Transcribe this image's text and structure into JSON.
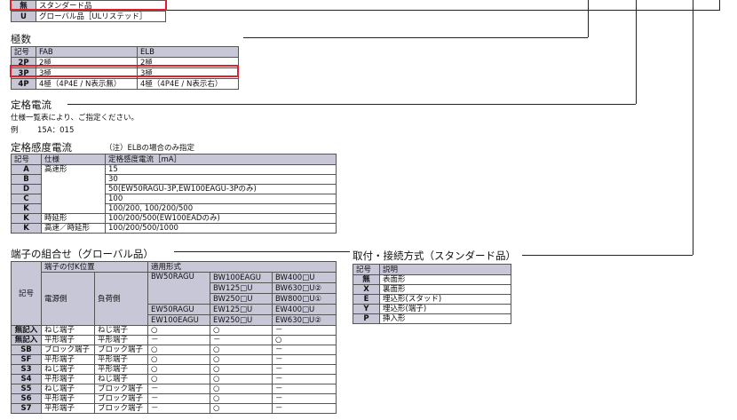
{
  "top_table": {
    "rows": [
      {
        "code": "無",
        "desc": "スタンダード品"
      },
      {
        "code": "U",
        "desc": "グローバル品［ULリステッド］"
      }
    ]
  },
  "poles": {
    "title": "極数",
    "headers": [
      "記号",
      "FAB",
      "ELB"
    ],
    "rows": [
      {
        "code": "2P",
        "fab": "2極",
        "elb": "2極"
      },
      {
        "code": "3P",
        "fab": "3極",
        "elb": "3極"
      },
      {
        "code": "4P",
        "fab": "4極（4P4E / N表示無）",
        "elb": "4極（4P4E / N表示右）"
      }
    ]
  },
  "rated_current": {
    "title": "定格電流",
    "line1": "仕様一覧表により、ご指定ください。",
    "example_label": "例",
    "example_value": "15A：015"
  },
  "sensitivity": {
    "title": "定格感度電流",
    "note": "（注）ELBの場合のみ指定",
    "headers": [
      "記号",
      "仕様",
      "定格感度電流［mA］"
    ],
    "spec_fast": "高速形",
    "rows": [
      {
        "code": "A",
        "value": "15"
      },
      {
        "code": "B",
        "value": "30"
      },
      {
        "code": "D",
        "value": "50(EW50RAGU-3P,EW100EAGU-3Pのみ)"
      },
      {
        "code": "C",
        "value": "100"
      },
      {
        "code": "K",
        "value": "100/200, 100/200/500"
      },
      {
        "code": "K",
        "spec": "時延形",
        "value": "100/200/500(EW100EADのみ)"
      },
      {
        "code": "K",
        "spec": "高速／時延形",
        "value": "100/200/500/1000"
      }
    ]
  },
  "terminals": {
    "title": "端子の組合せ（グローバル品）",
    "h_pos": "端子の付K位置",
    "h_models": "適用形式",
    "h_code": "記号",
    "h_power": "電源側",
    "h_load": "負荷側",
    "models": {
      "r1c1": "BW50RAGU",
      "r1c2": "BW100EAGU",
      "r1c3": "BW400□U",
      "r2c2": "BW125□U",
      "r2c3": "BW630□U②",
      "r3c2": "BW250□U",
      "r3c3": "BW800□U①",
      "r4c1": "EW50RAGU",
      "r4c2": "EW125□U",
      "r4c3": "EW400□U",
      "r5c1": "EW100EAGU",
      "r5c2": "EW250□U",
      "r5c3": "EW630□U②"
    },
    "rows": [
      {
        "code": "無記入",
        "power": "ねじ端子",
        "load": "ねじ端子",
        "m1": "○",
        "m2": "○",
        "m3": "－"
      },
      {
        "code": "無記入",
        "power": "平形端子",
        "load": "平形端子",
        "m1": "－",
        "m2": "－",
        "m3": "○"
      },
      {
        "code": "SB",
        "power": "ブロック端子",
        "load": "ブロック端子",
        "m1": "○",
        "m2": "○",
        "m3": "－"
      },
      {
        "code": "SF",
        "power": "平形端子",
        "load": "平形端子",
        "m1": "○",
        "m2": "○",
        "m3": "－"
      },
      {
        "code": "S3",
        "power": "ねじ端子",
        "load": "平形端子",
        "m1": "○",
        "m2": "○",
        "m3": "－"
      },
      {
        "code": "S4",
        "power": "平形端子",
        "load": "ねじ端子",
        "m1": "○",
        "m2": "○",
        "m3": "－"
      },
      {
        "code": "S5",
        "power": "ねじ端子",
        "load": "ブロック端子",
        "m1": "－",
        "m2": "○",
        "m3": "－"
      },
      {
        "code": "S6",
        "power": "平形端子",
        "load": "ブロック端子",
        "m1": "－",
        "m2": "○",
        "m3": "－"
      },
      {
        "code": "S7",
        "power": "平形端子",
        "load": "ブロック端子",
        "m1": "－",
        "m2": "○",
        "m3": "－"
      }
    ]
  },
  "mounting": {
    "title": "取付・接続方式（スタンダード品）",
    "headers": [
      "記号",
      "説明"
    ],
    "rows": [
      {
        "code": "無",
        "desc": "表面形"
      },
      {
        "code": "X",
        "desc": "裏面形"
      },
      {
        "code": "E",
        "desc": "埋込形(スタッド)"
      },
      {
        "code": "Y",
        "desc": "埋込形(端子)"
      },
      {
        "code": "P",
        "desc": "挿入形"
      }
    ]
  },
  "colors": {
    "header_bg": "#c7c7d8",
    "highlight": "#e0202a",
    "line": "#222222"
  }
}
